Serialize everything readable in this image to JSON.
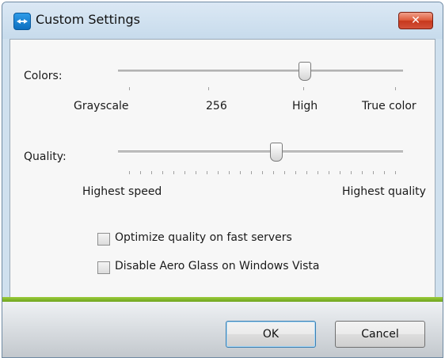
{
  "window": {
    "title": "Custom Settings",
    "close_glyph": "✕"
  },
  "colors_slider": {
    "label": "Colors:",
    "positions": [
      "Grayscale",
      "256",
      "High",
      "True color"
    ],
    "selected": "High"
  },
  "quality_slider": {
    "label": "Quality:",
    "min_label": "Highest speed",
    "max_label": "Highest quality",
    "value_fraction": 0.55
  },
  "options": [
    {
      "label": "Optimize quality on fast servers",
      "checked": false
    },
    {
      "label": "Disable Aero Glass on Windows Vista",
      "checked": false
    }
  ],
  "buttons": {
    "ok": "OK",
    "cancel": "Cancel"
  },
  "colors": {
    "accent_band": "#8cc63f",
    "title_bg": "#d3e3f1"
  }
}
